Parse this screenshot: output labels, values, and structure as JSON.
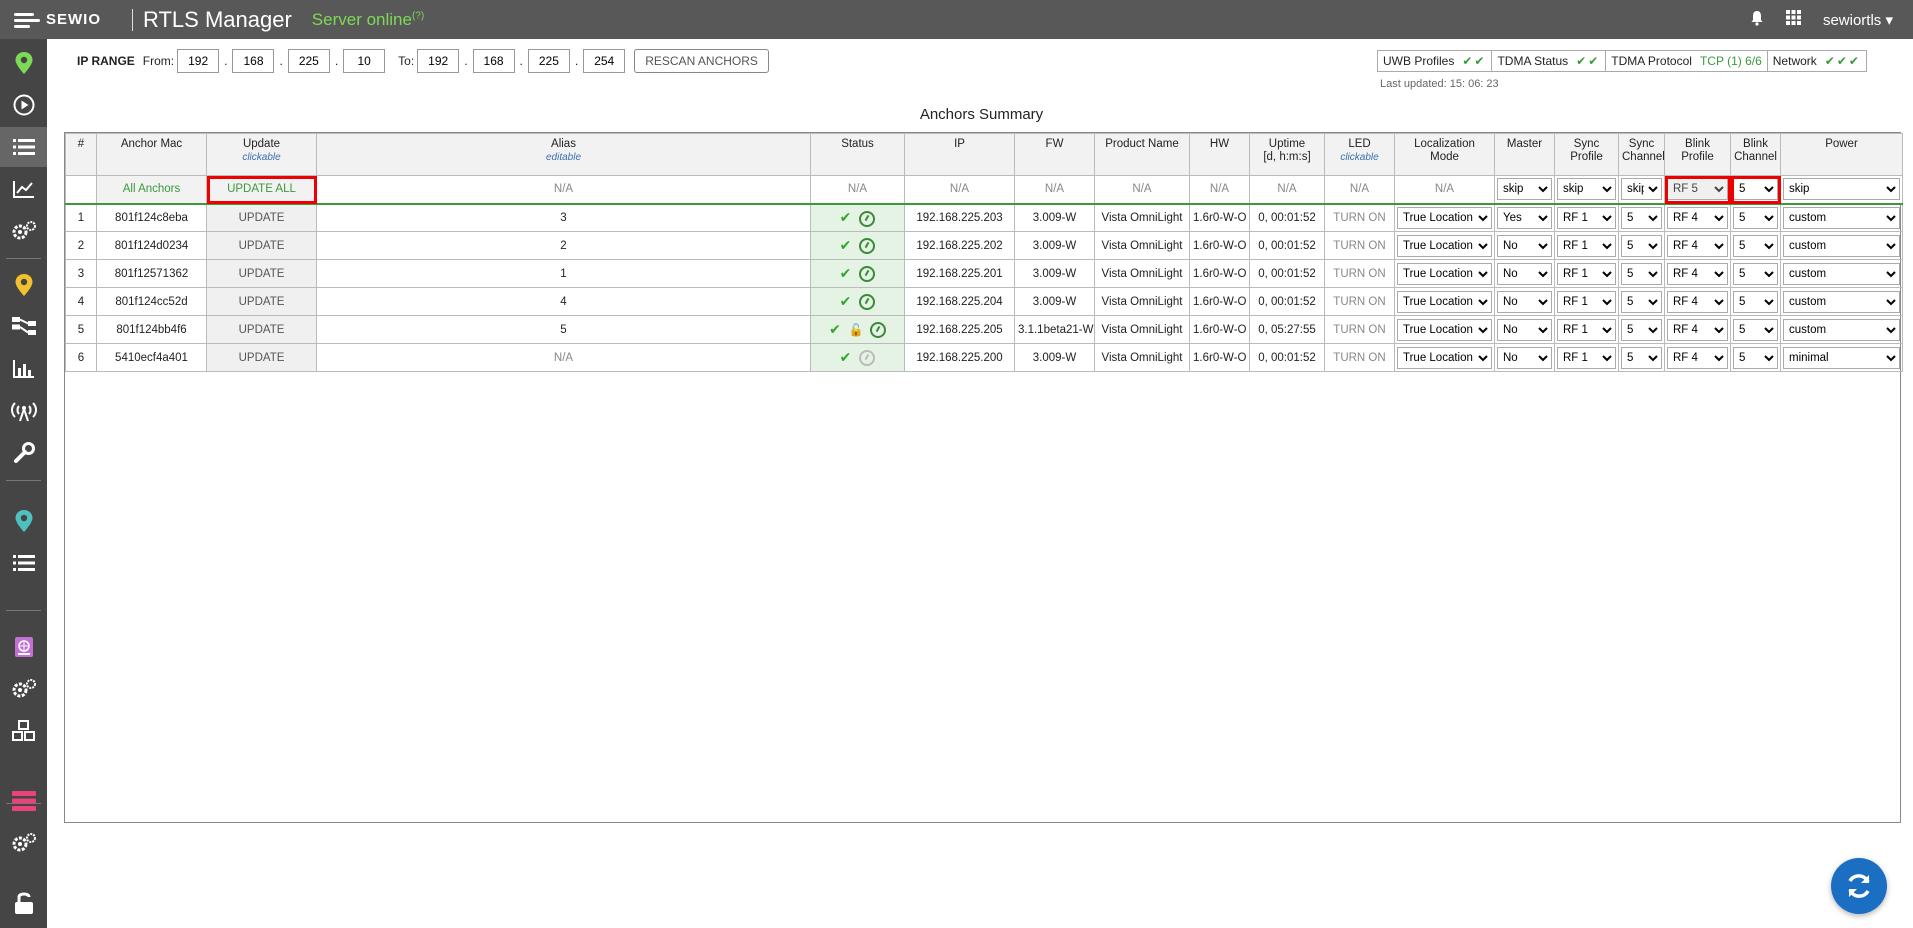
{
  "topbar": {
    "logo_text": "SEWIO",
    "app_title": "RTLS Manager",
    "server_status": "Server online",
    "server_status_sup": "(?)",
    "username": "sewiortls",
    "bell_icon": "bell-icon",
    "grid_icon": "apps-grid-icon"
  },
  "iprange": {
    "label": "IP RANGE",
    "from_label": "From:",
    "to_label": "To:",
    "from": [
      "192",
      "168",
      "225",
      "10"
    ],
    "to": [
      "192",
      "168",
      "225",
      "254"
    ],
    "rescan_label": "RESCAN ANCHORS"
  },
  "statuspanel": {
    "uwb_profiles": "UWB Profiles",
    "uwb_checks": "✔✔",
    "tdma_status": "TDMA Status",
    "tdma_status_checks": "✔✔",
    "tdma_protocol": "TDMA Protocol",
    "tdma_protocol_value": "TCP (1) 6/6",
    "network": "Network",
    "network_checks": "✔✔✔",
    "last_updated": "Last updated: 15: 06: 23"
  },
  "summary_title": "Anchors Summary",
  "table": {
    "headers": {
      "num": "#",
      "mac": "Anchor Mac",
      "update": "Update",
      "update_sub": "clickable",
      "alias": "Alias",
      "alias_sub": "editable",
      "status": "Status",
      "ip": "IP",
      "fw": "FW",
      "product": "Product Name",
      "hw": "HW",
      "uptime": "Uptime",
      "uptime_sub": "[d, h:m:s]",
      "led": "LED",
      "led_sub": "clickable",
      "locmode": "Localization",
      "locmode_2": "Mode",
      "master": "Master",
      "syncprof": "Sync",
      "syncprof_2": "Profile",
      "syncch": "Sync",
      "syncch_2": "Channel",
      "blinkprof": "Blink",
      "blinkprof_2": "Profile",
      "blinkch": "Blink",
      "blinkch_2": "Channel",
      "power": "Power"
    },
    "all_row": {
      "label": "All Anchors",
      "update_all": "UPDATE ALL",
      "na": "N/A",
      "master": "skip",
      "sync_profile": "skip",
      "sync_channel": "skip",
      "blink_profile": "RF 5",
      "blink_channel": "5",
      "power": "skip"
    },
    "rows": [
      {
        "num": "1",
        "mac": "801f124c8eba",
        "update": "UPDATE",
        "alias": "3",
        "lock": false,
        "gauge": "on",
        "ip": "192.168.225.203",
        "fw": "3.009-W",
        "product": "Vista OmniLight",
        "hw": "1.6r0-W-O",
        "uptime": "0, 00:01:52",
        "led": "TURN ON",
        "locmode": "True Location",
        "master": "Yes",
        "sync_profile": "RF 1",
        "sync_channel": "5",
        "blink_profile": "RF 4",
        "blink_channel": "5",
        "power": "custom"
      },
      {
        "num": "2",
        "mac": "801f124d0234",
        "update": "UPDATE",
        "alias": "2",
        "lock": false,
        "gauge": "on",
        "ip": "192.168.225.202",
        "fw": "3.009-W",
        "product": "Vista OmniLight",
        "hw": "1.6r0-W-O",
        "uptime": "0, 00:01:52",
        "led": "TURN ON",
        "locmode": "True Location",
        "master": "No",
        "sync_profile": "RF 1",
        "sync_channel": "5",
        "blink_profile": "RF 4",
        "blink_channel": "5",
        "power": "custom"
      },
      {
        "num": "3",
        "mac": "801f12571362",
        "update": "UPDATE",
        "alias": "1",
        "lock": false,
        "gauge": "on",
        "ip": "192.168.225.201",
        "fw": "3.009-W",
        "product": "Vista OmniLight",
        "hw": "1.6r0-W-O",
        "uptime": "0, 00:01:52",
        "led": "TURN ON",
        "locmode": "True Location",
        "master": "No",
        "sync_profile": "RF 1",
        "sync_channel": "5",
        "blink_profile": "RF 4",
        "blink_channel": "5",
        "power": "custom"
      },
      {
        "num": "4",
        "mac": "801f124cc52d",
        "update": "UPDATE",
        "alias": "4",
        "lock": false,
        "gauge": "on",
        "ip": "192.168.225.204",
        "fw": "3.009-W",
        "product": "Vista OmniLight",
        "hw": "1.6r0-W-O",
        "uptime": "0, 00:01:52",
        "led": "TURN ON",
        "locmode": "True Location",
        "master": "No",
        "sync_profile": "RF 1",
        "sync_channel": "5",
        "blink_profile": "RF 4",
        "blink_channel": "5",
        "power": "custom"
      },
      {
        "num": "5",
        "mac": "801f124bb4f6",
        "update": "UPDATE",
        "alias": "5",
        "lock": true,
        "gauge": "on",
        "ip": "192.168.225.205",
        "fw": "3.1.1beta21-W",
        "product": "Vista OmniLight",
        "hw": "1.6r0-W-O",
        "uptime": "0, 05:27:55",
        "led": "TURN ON",
        "locmode": "True Location",
        "master": "No",
        "sync_profile": "RF 1",
        "sync_channel": "5",
        "blink_profile": "RF 4",
        "blink_channel": "5",
        "power": "custom"
      },
      {
        "num": "6",
        "mac": "5410ecf4a401",
        "update": "UPDATE",
        "alias": "N/A",
        "lock": false,
        "gauge": "off",
        "ip": "192.168.225.200",
        "fw": "3.009-W",
        "product": "Vista OmniLight",
        "hw": "1.6r0-W-O",
        "uptime": "0, 00:01:52",
        "led": "TURN ON",
        "locmode": "True Location",
        "master": "No",
        "sync_profile": "RF 1",
        "sync_channel": "5",
        "blink_profile": "RF 4",
        "blink_channel": "5",
        "power": "minimal"
      }
    ]
  },
  "sidebar_icons": [
    "map-pin-icon",
    "play-icon",
    "list-icon",
    "chart-icon",
    "settings-icon",
    "location-pin-icon",
    "network-icon",
    "bar-chart-icon",
    "antenna-icon",
    "wrench-icon",
    "map-marker-icon",
    "list-icon",
    "globe-book-icon",
    "settings-icon",
    "cubes-icon",
    "server-icon",
    "settings-icon",
    "unlock-icon"
  ],
  "colors": {
    "topbar": "#585858",
    "sidebar": "#454545",
    "accent_green": "#3a9a3a",
    "highlight_red": "#e00000",
    "refresh_blue": "#1b6fc2"
  }
}
